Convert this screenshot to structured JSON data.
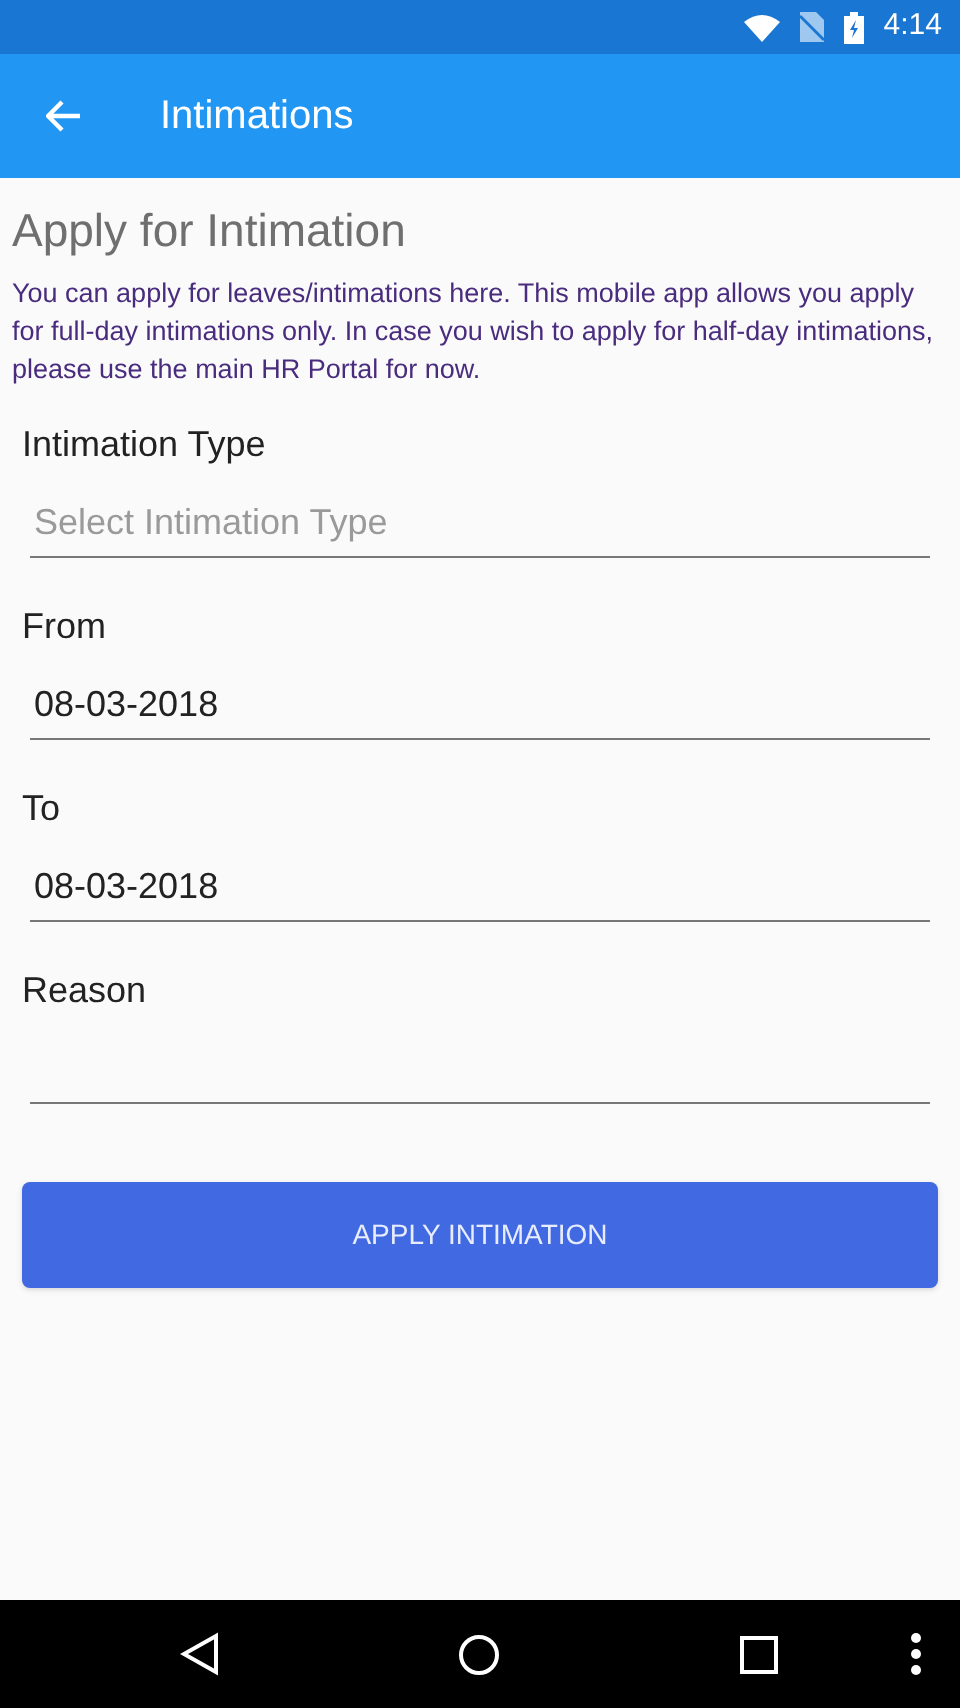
{
  "status_bar": {
    "time": "4:14"
  },
  "app_bar": {
    "title": "Intimations"
  },
  "heading": "Apply for Intimation",
  "description": "You can apply for leaves/intimations here. This mobile app allows you apply for full-day intimations only. In case you wish to apply for half-day intimations, please use the main HR Portal for now.",
  "fields": [
    {
      "label": "Intimation Type",
      "placeholder": "Select Intimation Type"
    },
    {
      "label": "From",
      "value": "08-03-2018"
    },
    {
      "label": "To",
      "value": "08-03-2018"
    },
    {
      "label": "Reason"
    }
  ],
  "button": "APPLY INTIMATION"
}
